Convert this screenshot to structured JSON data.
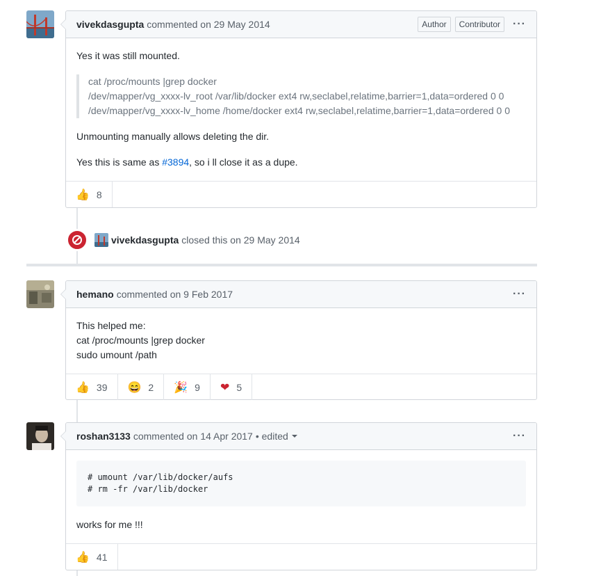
{
  "comments": [
    {
      "author": "vivekdasgupta",
      "meta": "commented on 29 May 2014",
      "badges": [
        "Author",
        "Contributor"
      ],
      "body": {
        "line1": "Yes it was still mounted.",
        "quote": [
          "cat /proc/mounts |grep docker",
          "/dev/mapper/vg_xxxx-lv_root /var/lib/docker ext4 rw,seclabel,relatime,barrier=1,data=ordered 0 0",
          "/dev/mapper/vg_xxxx-lv_home /home/docker ext4 rw,seclabel,relatime,barrier=1,data=ordered 0 0"
        ],
        "line2": "Unmounting manually allows deleting the dir.",
        "line3_pre": "Yes this is same as ",
        "line3_link": "#3894",
        "line3_post": ", so i ll close it as a dupe."
      },
      "reactions": [
        {
          "emoji": "👍",
          "icon": "thumbs-up-icon",
          "count": "8"
        }
      ]
    },
    {
      "author": "hemano",
      "meta": "commented on 9 Feb 2017",
      "body": {
        "lines": [
          "This helped me:",
          "cat /proc/mounts |grep docker",
          "sudo umount /path"
        ]
      },
      "reactions": [
        {
          "emoji": "👍",
          "icon": "thumbs-up-icon",
          "count": "39"
        },
        {
          "emoji": "😄",
          "icon": "laugh-icon",
          "count": "2"
        },
        {
          "emoji": "🎉",
          "icon": "hooray-icon",
          "count": "9"
        },
        {
          "emoji": "❤",
          "icon": "heart-icon",
          "count": "5"
        }
      ]
    },
    {
      "author": "roshan3133",
      "meta": "commented on 14 Apr 2017",
      "edited": "• edited",
      "body": {
        "code": [
          "# umount /var/lib/docker/aufs",
          "# rm -fr /var/lib/docker"
        ],
        "line1": "works for me !!!"
      },
      "reactions": [
        {
          "emoji": "👍",
          "icon": "thumbs-up-icon",
          "count": "41"
        }
      ]
    }
  ],
  "closed_event": {
    "author": "vivekdasgupta",
    "text": "closed this on 29 May 2014"
  },
  "more_label": "···",
  "colors": {
    "closed_red": "#cb2431",
    "link_blue": "#0366d6",
    "border": "#d1d5da"
  }
}
